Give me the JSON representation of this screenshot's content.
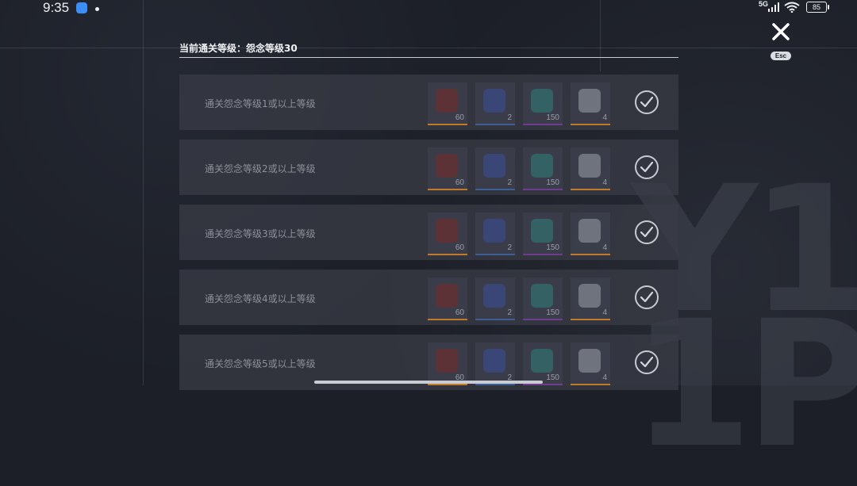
{
  "status_bar": {
    "time": "9:35",
    "network": "5G",
    "battery": "85"
  },
  "close": {
    "esc_label": "Esc"
  },
  "header": {
    "title": "当前通关等级：怨念等级30"
  },
  "rewards": [
    {
      "label": "通关怨念等级1或以上等级",
      "items": [
        {
          "icon": "red-figure-icon",
          "count": "60",
          "rarity": "orange"
        },
        {
          "icon": "blue-gem-icon",
          "count": "2",
          "rarity": "blue"
        },
        {
          "icon": "teal-figure-icon",
          "count": "150",
          "rarity": "purple"
        },
        {
          "icon": "white-shard-icon",
          "count": "4",
          "rarity": "orange"
        }
      ],
      "claimed": true
    },
    {
      "label": "通关怨念等级2或以上等级",
      "items": [
        {
          "icon": "red-figure-icon",
          "count": "60",
          "rarity": "orange"
        },
        {
          "icon": "blue-gem-icon",
          "count": "2",
          "rarity": "blue"
        },
        {
          "icon": "teal-figure-icon",
          "count": "150",
          "rarity": "purple"
        },
        {
          "icon": "white-shard-icon",
          "count": "4",
          "rarity": "orange"
        }
      ],
      "claimed": true
    },
    {
      "label": "通关怨念等级3或以上等级",
      "items": [
        {
          "icon": "red-figure-icon",
          "count": "60",
          "rarity": "orange"
        },
        {
          "icon": "blue-gem-icon",
          "count": "2",
          "rarity": "blue"
        },
        {
          "icon": "teal-figure-icon",
          "count": "150",
          "rarity": "purple"
        },
        {
          "icon": "white-shard-icon",
          "count": "4",
          "rarity": "orange"
        }
      ],
      "claimed": true
    },
    {
      "label": "通关怨念等级4或以上等级",
      "items": [
        {
          "icon": "red-figure-icon",
          "count": "60",
          "rarity": "orange"
        },
        {
          "icon": "blue-gem-icon",
          "count": "2",
          "rarity": "blue"
        },
        {
          "icon": "teal-figure-icon",
          "count": "150",
          "rarity": "purple"
        },
        {
          "icon": "white-shard-icon",
          "count": "4",
          "rarity": "orange"
        }
      ],
      "claimed": true
    },
    {
      "label": "通关怨念等级5或以上等级",
      "items": [
        {
          "icon": "red-figure-icon",
          "count": "60",
          "rarity": "orange"
        },
        {
          "icon": "blue-gem-icon",
          "count": "2",
          "rarity": "blue"
        },
        {
          "icon": "teal-figure-icon",
          "count": "150",
          "rarity": "purple"
        },
        {
          "icon": "white-shard-icon",
          "count": "4",
          "rarity": "orange"
        }
      ],
      "claimed": true
    }
  ],
  "colors": {
    "red_figure": "#7a2a28",
    "blue_gem": "#3a4f9a",
    "teal_figure": "#2d7f7a",
    "white_shard": "#9aa0aa"
  }
}
